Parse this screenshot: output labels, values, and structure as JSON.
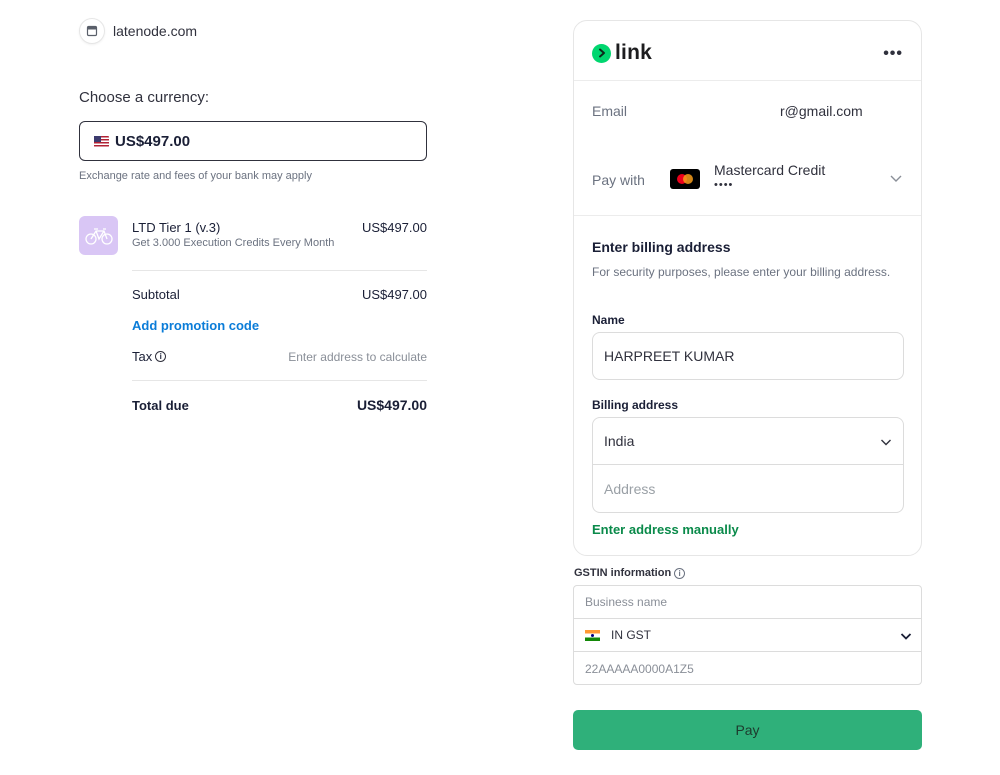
{
  "merchant": {
    "name": "latenode.com",
    "icon": "store-icon"
  },
  "currency": {
    "title": "Choose a currency:",
    "selected": "US$497.00",
    "flag": "us-flag-icon",
    "note": "Exchange rate and fees of your bank may apply"
  },
  "product": {
    "name": "LTD Tier 1 (v.3)",
    "description": "Get 3.000 Execution Credits Every Month",
    "price": "US$497.00",
    "icon": "bicycle-icon"
  },
  "summary": {
    "subtotal_label": "Subtotal",
    "subtotal_value": "US$497.00",
    "promo_label": "Add promotion code",
    "tax_label": "Tax",
    "tax_value": "Enter address to calculate",
    "total_label": "Total due",
    "total_value": "US$497.00"
  },
  "link": {
    "brand": "link",
    "more": "•••",
    "email_label": "Email",
    "email_value": "r@gmail.com",
    "pay_with_label": "Pay with",
    "card_name": "Mastercard Credit",
    "card_mask": "••••"
  },
  "billing": {
    "title": "Enter billing address",
    "description": "For security purposes, please enter your billing address.",
    "name_label": "Name",
    "name_value": "HARPREET KUMAR",
    "address_label": "Billing address",
    "country": "India",
    "address_placeholder": "Address",
    "manual_link": "Enter address manually"
  },
  "gstin": {
    "title": "GSTIN information",
    "business_placeholder": "Business name",
    "type": "IN GST",
    "number_placeholder": "22AAAAA0000A1Z5"
  },
  "pay_button": "Pay",
  "colors": {
    "accent_green": "#2fb07a",
    "link_green": "#00d66f",
    "promo_blue": "#0a7cd8",
    "manual_green": "#0a8a4a",
    "product_bg": "#d9c6f5"
  }
}
